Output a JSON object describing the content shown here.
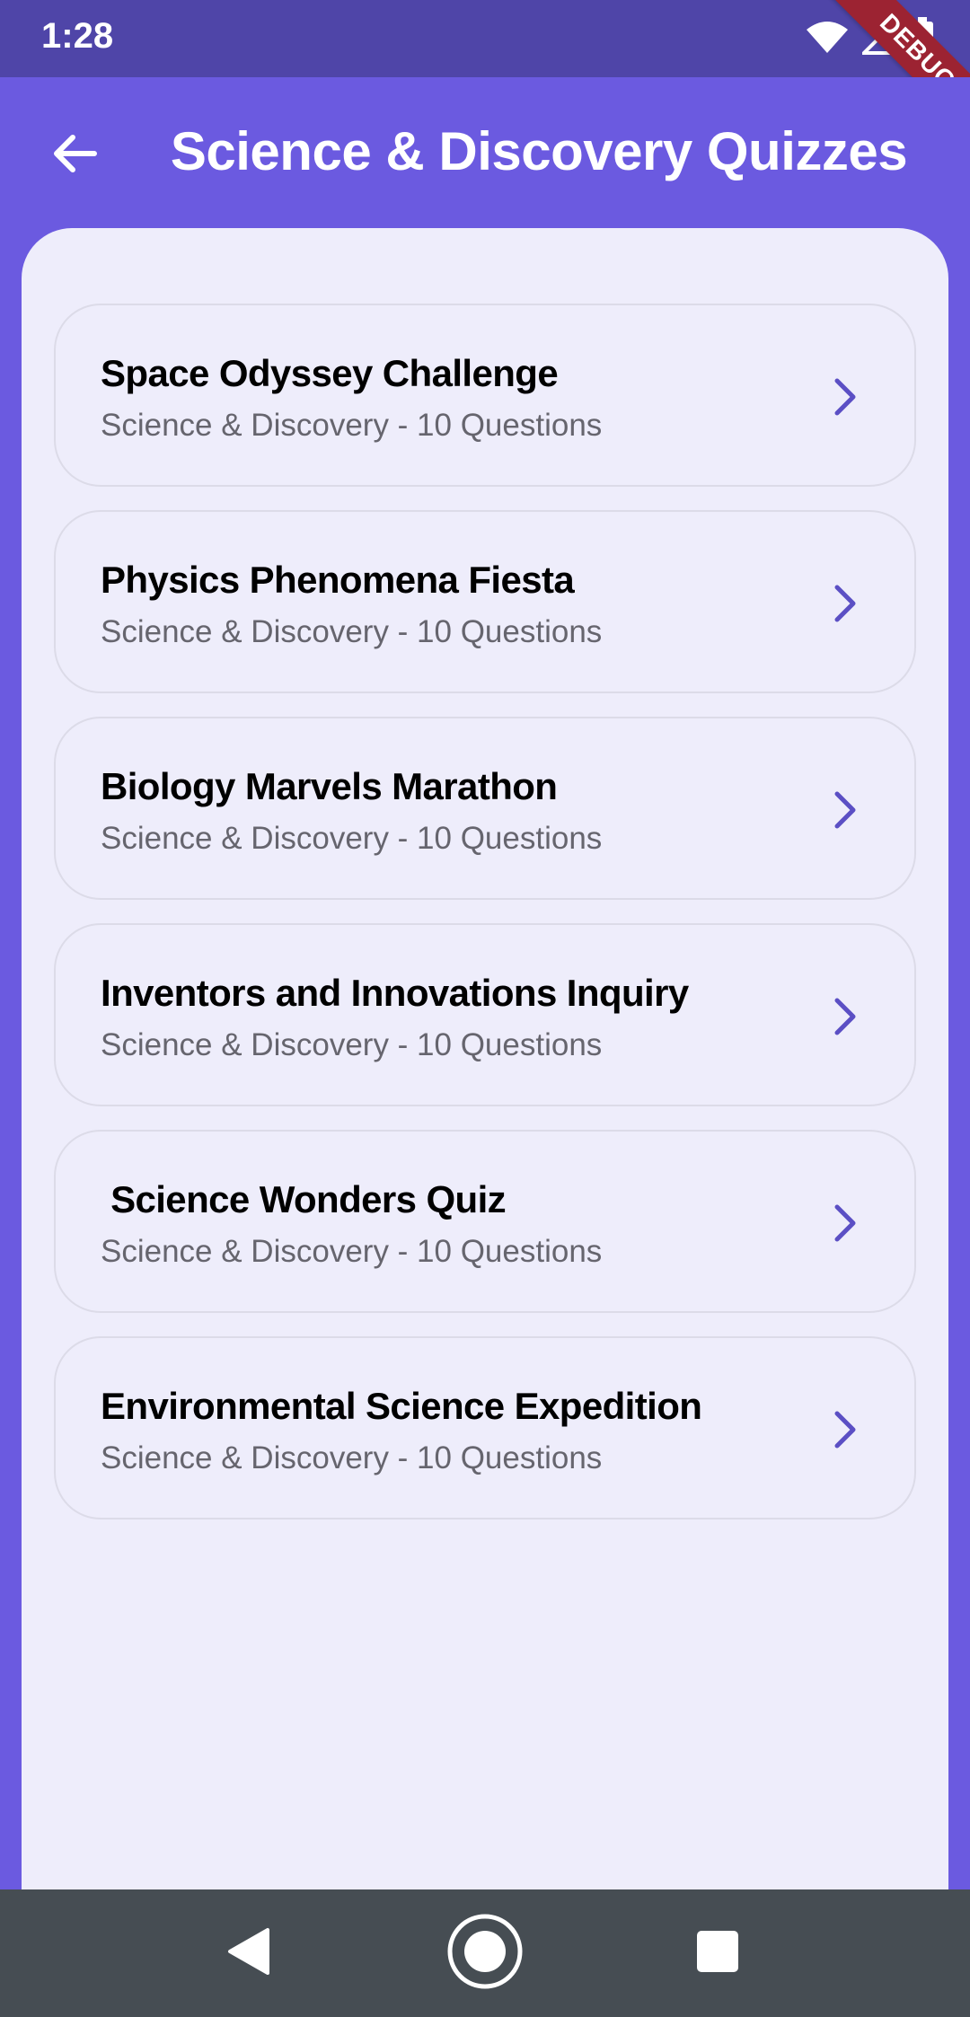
{
  "status_bar": {
    "time": "1:28",
    "battery_level": "75",
    "debug_label": "DEBUG"
  },
  "app_bar": {
    "title": "Science & Discovery Quizzes",
    "back_icon": "arrow-left-icon"
  },
  "quizzes": [
    {
      "title": "Space Odyssey Challenge",
      "subtitle": "Science & Discovery - 10 Questions"
    },
    {
      "title": "Physics Phenomena Fiesta",
      "subtitle": "Science & Discovery - 10 Questions"
    },
    {
      "title": "Biology Marvels Marathon",
      "subtitle": "Science & Discovery - 10 Questions"
    },
    {
      "title": "Inventors and Innovations Inquiry",
      "subtitle": "Science & Discovery - 10 Questions"
    },
    {
      "title": " Science Wonders Quiz",
      "subtitle": "Science & Discovery - 10 Questions"
    },
    {
      "title": "Environmental Science Expedition",
      "subtitle": "Science & Discovery - 10 Questions"
    }
  ],
  "colors": {
    "primary": "#6b5ae0",
    "status_bar": "#4f45a8",
    "panel_background": "#eeedfb",
    "chevron": "#5b4fc4",
    "nav_bar": "#464d53",
    "debug_banner": "#9c2332"
  },
  "nav_bar": {
    "back_icon": "triangle-back-icon",
    "home_icon": "circle-home-icon",
    "recents_icon": "square-recents-icon"
  }
}
